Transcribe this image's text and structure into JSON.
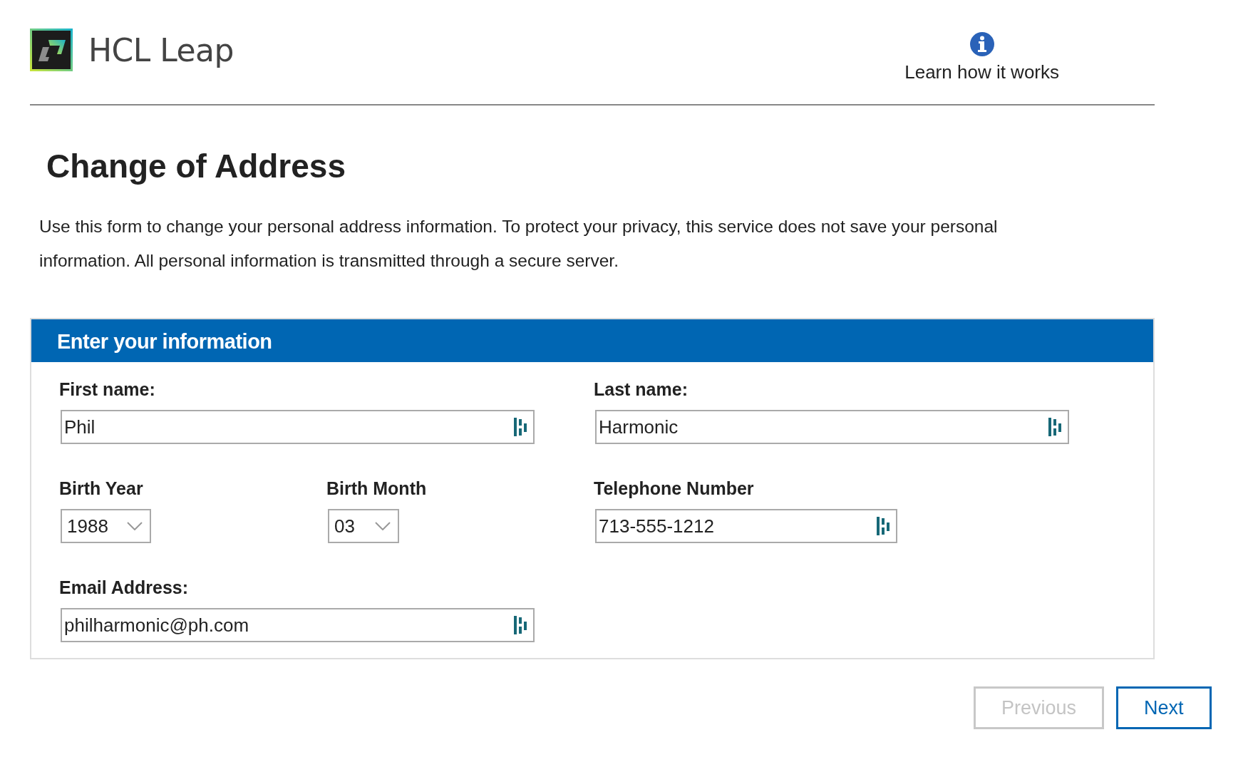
{
  "header": {
    "brand": "HCL Leap",
    "help_link": "Learn how it works"
  },
  "page": {
    "title": "Change of Address",
    "intro": "Use this form to change your personal address information.  To protect your privacy, this service does not save your personal information. All personal information is transmitted through a secure server."
  },
  "panel": {
    "title": "Enter your information",
    "fields": [
      {
        "kind": "text",
        "label": "First name:",
        "value": "Phil"
      },
      {
        "kind": "text",
        "label": "Last name:",
        "value": "Harmonic"
      },
      {
        "kind": "select",
        "label": "Birth Year",
        "value": "1988"
      },
      {
        "kind": "select",
        "label": "Birth Month",
        "value": "03"
      },
      {
        "kind": "phone",
        "label": "Telephone Number",
        "value": "713-555-1212"
      },
      {
        "kind": "text",
        "label": "Email Address:",
        "value": "philharmonic@ph.com"
      }
    ]
  },
  "buttons": [
    {
      "label": "Previous",
      "disabled": true
    },
    {
      "label": "Next",
      "disabled": false
    }
  ]
}
